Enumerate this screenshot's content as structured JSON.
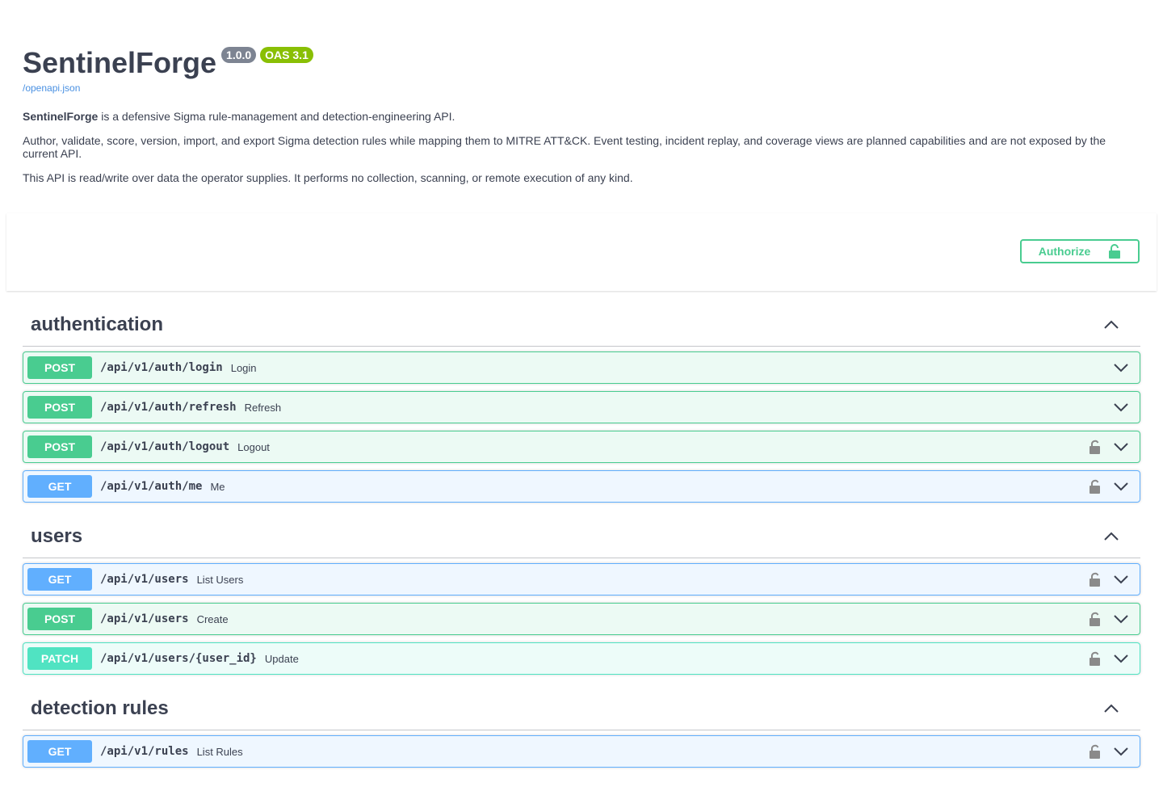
{
  "info": {
    "title": "SentinelForge",
    "version": "1.0.0",
    "oas": "OAS 3.1",
    "spec_link": "/openapi.json",
    "desc_strong": "SentinelForge",
    "desc_p1_rest": " is a defensive Sigma rule-management and detection-engineering API.",
    "desc_p2": "Author, validate, score, version, import, and export Sigma detection rules while mapping them to MITRE ATT&CK. Event testing, incident replay, and coverage views are planned capabilities and are not exposed by the current API.",
    "desc_p3": "This API is read/write over data the operator supplies. It performs no collection, scanning, or remote execution of any kind."
  },
  "authorize": {
    "label": "Authorize",
    "icon": "unlocked-lock-icon",
    "color": "#49cc90"
  },
  "colors": {
    "post": "#49cc90",
    "get": "#61affe",
    "patch": "#50e3c2"
  },
  "tags": [
    {
      "name": "authentication",
      "operations": [
        {
          "method": "POST",
          "path": "/api/v1/auth/login",
          "summary": "Login",
          "locked": false
        },
        {
          "method": "POST",
          "path": "/api/v1/auth/refresh",
          "summary": "Refresh",
          "locked": false
        },
        {
          "method": "POST",
          "path": "/api/v1/auth/logout",
          "summary": "Logout",
          "locked": true
        },
        {
          "method": "GET",
          "path": "/api/v1/auth/me",
          "summary": "Me",
          "locked": true
        }
      ]
    },
    {
      "name": "users",
      "operations": [
        {
          "method": "GET",
          "path": "/api/v1/users",
          "summary": "List Users",
          "locked": true
        },
        {
          "method": "POST",
          "path": "/api/v1/users",
          "summary": "Create",
          "locked": true
        },
        {
          "method": "PATCH",
          "path": "/api/v1/users/{user_id}",
          "summary": "Update",
          "locked": true
        }
      ]
    },
    {
      "name": "detection rules",
      "operations": [
        {
          "method": "GET",
          "path": "/api/v1/rules",
          "summary": "List Rules",
          "locked": true
        }
      ]
    }
  ]
}
